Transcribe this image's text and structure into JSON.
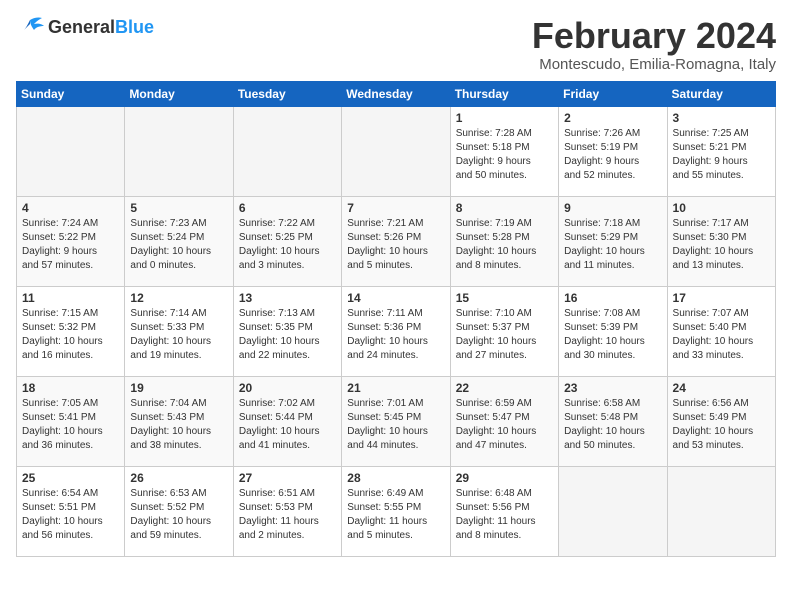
{
  "header": {
    "logo_general": "General",
    "logo_blue": "Blue",
    "title": "February 2024",
    "subtitle": "Montescudo, Emilia-Romagna, Italy"
  },
  "days_of_week": [
    "Sunday",
    "Monday",
    "Tuesday",
    "Wednesday",
    "Thursday",
    "Friday",
    "Saturday"
  ],
  "weeks": [
    [
      {
        "day": "",
        "info": ""
      },
      {
        "day": "",
        "info": ""
      },
      {
        "day": "",
        "info": ""
      },
      {
        "day": "",
        "info": ""
      },
      {
        "day": "1",
        "info": "Sunrise: 7:28 AM\nSunset: 5:18 PM\nDaylight: 9 hours\nand 50 minutes."
      },
      {
        "day": "2",
        "info": "Sunrise: 7:26 AM\nSunset: 5:19 PM\nDaylight: 9 hours\nand 52 minutes."
      },
      {
        "day": "3",
        "info": "Sunrise: 7:25 AM\nSunset: 5:21 PM\nDaylight: 9 hours\nand 55 minutes."
      }
    ],
    [
      {
        "day": "4",
        "info": "Sunrise: 7:24 AM\nSunset: 5:22 PM\nDaylight: 9 hours\nand 57 minutes."
      },
      {
        "day": "5",
        "info": "Sunrise: 7:23 AM\nSunset: 5:24 PM\nDaylight: 10 hours\nand 0 minutes."
      },
      {
        "day": "6",
        "info": "Sunrise: 7:22 AM\nSunset: 5:25 PM\nDaylight: 10 hours\nand 3 minutes."
      },
      {
        "day": "7",
        "info": "Sunrise: 7:21 AM\nSunset: 5:26 PM\nDaylight: 10 hours\nand 5 minutes."
      },
      {
        "day": "8",
        "info": "Sunrise: 7:19 AM\nSunset: 5:28 PM\nDaylight: 10 hours\nand 8 minutes."
      },
      {
        "day": "9",
        "info": "Sunrise: 7:18 AM\nSunset: 5:29 PM\nDaylight: 10 hours\nand 11 minutes."
      },
      {
        "day": "10",
        "info": "Sunrise: 7:17 AM\nSunset: 5:30 PM\nDaylight: 10 hours\nand 13 minutes."
      }
    ],
    [
      {
        "day": "11",
        "info": "Sunrise: 7:15 AM\nSunset: 5:32 PM\nDaylight: 10 hours\nand 16 minutes."
      },
      {
        "day": "12",
        "info": "Sunrise: 7:14 AM\nSunset: 5:33 PM\nDaylight: 10 hours\nand 19 minutes."
      },
      {
        "day": "13",
        "info": "Sunrise: 7:13 AM\nSunset: 5:35 PM\nDaylight: 10 hours\nand 22 minutes."
      },
      {
        "day": "14",
        "info": "Sunrise: 7:11 AM\nSunset: 5:36 PM\nDaylight: 10 hours\nand 24 minutes."
      },
      {
        "day": "15",
        "info": "Sunrise: 7:10 AM\nSunset: 5:37 PM\nDaylight: 10 hours\nand 27 minutes."
      },
      {
        "day": "16",
        "info": "Sunrise: 7:08 AM\nSunset: 5:39 PM\nDaylight: 10 hours\nand 30 minutes."
      },
      {
        "day": "17",
        "info": "Sunrise: 7:07 AM\nSunset: 5:40 PM\nDaylight: 10 hours\nand 33 minutes."
      }
    ],
    [
      {
        "day": "18",
        "info": "Sunrise: 7:05 AM\nSunset: 5:41 PM\nDaylight: 10 hours\nand 36 minutes."
      },
      {
        "day": "19",
        "info": "Sunrise: 7:04 AM\nSunset: 5:43 PM\nDaylight: 10 hours\nand 38 minutes."
      },
      {
        "day": "20",
        "info": "Sunrise: 7:02 AM\nSunset: 5:44 PM\nDaylight: 10 hours\nand 41 minutes."
      },
      {
        "day": "21",
        "info": "Sunrise: 7:01 AM\nSunset: 5:45 PM\nDaylight: 10 hours\nand 44 minutes."
      },
      {
        "day": "22",
        "info": "Sunrise: 6:59 AM\nSunset: 5:47 PM\nDaylight: 10 hours\nand 47 minutes."
      },
      {
        "day": "23",
        "info": "Sunrise: 6:58 AM\nSunset: 5:48 PM\nDaylight: 10 hours\nand 50 minutes."
      },
      {
        "day": "24",
        "info": "Sunrise: 6:56 AM\nSunset: 5:49 PM\nDaylight: 10 hours\nand 53 minutes."
      }
    ],
    [
      {
        "day": "25",
        "info": "Sunrise: 6:54 AM\nSunset: 5:51 PM\nDaylight: 10 hours\nand 56 minutes."
      },
      {
        "day": "26",
        "info": "Sunrise: 6:53 AM\nSunset: 5:52 PM\nDaylight: 10 hours\nand 59 minutes."
      },
      {
        "day": "27",
        "info": "Sunrise: 6:51 AM\nSunset: 5:53 PM\nDaylight: 11 hours\nand 2 minutes."
      },
      {
        "day": "28",
        "info": "Sunrise: 6:49 AM\nSunset: 5:55 PM\nDaylight: 11 hours\nand 5 minutes."
      },
      {
        "day": "29",
        "info": "Sunrise: 6:48 AM\nSunset: 5:56 PM\nDaylight: 11 hours\nand 8 minutes."
      },
      {
        "day": "",
        "info": ""
      },
      {
        "day": "",
        "info": ""
      }
    ]
  ]
}
